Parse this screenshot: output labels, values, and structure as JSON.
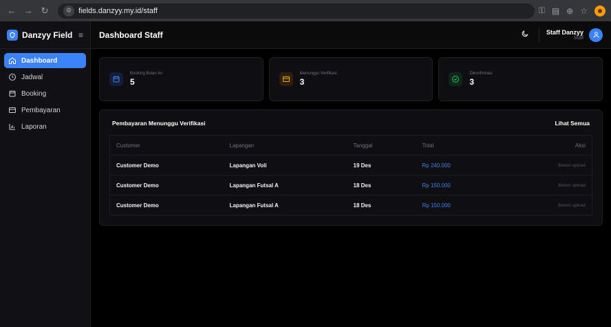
{
  "browser": {
    "url": "fields.danzyy.my.id/staff"
  },
  "sidebar": {
    "brand": "Danzyy Field",
    "items": [
      {
        "label": "Dashboard",
        "icon": "home-icon",
        "active": true
      },
      {
        "label": "Jadwal",
        "icon": "clock-icon",
        "active": false
      },
      {
        "label": "Booking",
        "icon": "calendar-icon",
        "active": false
      },
      {
        "label": "Pembayaran",
        "icon": "card-icon",
        "active": false
      },
      {
        "label": "Laporan",
        "icon": "bar-chart-icon",
        "active": false
      }
    ]
  },
  "header": {
    "title": "Dashboard Staff",
    "user_name": "Staff Danzyy",
    "user_role": "Staff"
  },
  "stats": [
    {
      "label": "Booking Bulan Ini",
      "value": "5",
      "icon": "calendar-icon",
      "color": "#3b82f6"
    },
    {
      "label": "Menunggu Verifikasi",
      "value": "3",
      "icon": "card-icon",
      "color": "#eab308"
    },
    {
      "label": "Dikonfirmasi",
      "value": "3",
      "icon": "check-circle-icon",
      "color": "#22c55e"
    }
  ],
  "panel": {
    "title": "Pembayaran Menunggu Verifikasi",
    "see_all": "Lihat Semua",
    "columns": [
      "Customer",
      "Lapangan",
      "Tanggal",
      "Total",
      "Aksi"
    ],
    "rows": [
      {
        "customer": "Customer Demo",
        "lapangan": "Lapangan Voli",
        "tanggal": "19 Des",
        "total": "Rp 240.000",
        "aksi": "Belum upload"
      },
      {
        "customer": "Customer Demo",
        "lapangan": "Lapangan Futsal A",
        "tanggal": "18 Des",
        "total": "Rp 150.000",
        "aksi": "Belum upload"
      },
      {
        "customer": "Customer Demo",
        "lapangan": "Lapangan Futsal A",
        "tanggal": "18 Des",
        "total": "Rp 150.000",
        "aksi": "Belum upload"
      }
    ]
  },
  "colors": {
    "accent": "#3b82f6"
  }
}
